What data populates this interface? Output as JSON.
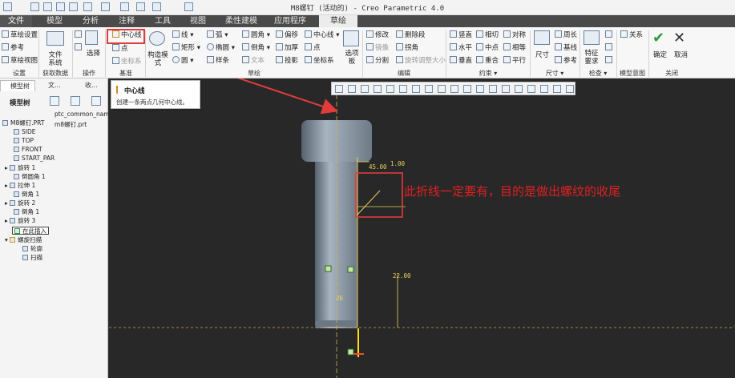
{
  "window": {
    "title": "M8螺钉 (活动的) - Creo Parametric 4.0"
  },
  "tabs": [
    {
      "label": "文件"
    },
    {
      "label": "模型"
    },
    {
      "label": "分析"
    },
    {
      "label": "注释"
    },
    {
      "label": "工具"
    },
    {
      "label": "视图"
    },
    {
      "label": "柔性建模"
    },
    {
      "label": "应用程序"
    },
    {
      "label": "草绘"
    }
  ],
  "ribbon": {
    "setup": {
      "sketch_setup": "草绘设置",
      "reference": "参考",
      "sketch_view": "草绘视图",
      "group": "设置"
    },
    "getdata": {
      "file_system": "文件系统",
      "group": "获取数据"
    },
    "operations": {
      "select": "选择",
      "group": "操作"
    },
    "datum": {
      "centerline": "中心线",
      "point": "点",
      "csys": "坐标系",
      "group": "基准"
    },
    "sketch": {
      "construction_mode": "构造模式",
      "line": "线",
      "rectangle": "矩形",
      "circle": "圆",
      "arc": "弧",
      "ellipse": "椭圆",
      "spline": "样条",
      "fillet": "圆角",
      "chamfer": "倒角",
      "text": "文本",
      "offset": "偏移",
      "thicken": "加厚",
      "project": "投影",
      "centerline": "中心线",
      "point": "点",
      "csys": "坐标系",
      "palette": "选项板",
      "group": "草绘"
    },
    "editing": {
      "modify": "修改",
      "mirror": "镜像",
      "divide": "分割",
      "delete_segment": "删除段",
      "corner": "拐角",
      "rotate_resize": "旋转调整大小",
      "group": "编辑"
    },
    "constrain": {
      "vertical": "竖直",
      "horizontal": "水平",
      "perpendicular": "垂直",
      "tangent": "相切",
      "midpoint": "中点",
      "coincident": "重合",
      "symmetric": "对称",
      "equal": "相等",
      "parallel": "平行",
      "group": "约束"
    },
    "dimension": {
      "dimension": "尺寸",
      "perimeter": "周长",
      "baseline": "基线",
      "reference": "参考",
      "group": "尺寸"
    },
    "inspect": {
      "feature_requirements": "特征要求",
      "relations": "关系",
      "group": "检查"
    },
    "model_intent": {
      "group": "模型意图"
    },
    "close": {
      "ok": "确定",
      "cancel": "取消",
      "group": "关闭"
    }
  },
  "tooltip": {
    "title": "中心线",
    "desc": "创建一条两点几何中心线。"
  },
  "panel": {
    "tabs": [
      {
        "label": "模型树"
      },
      {
        "label": "文..."
      },
      {
        "label": "收..."
      }
    ],
    "label": "模型树",
    "column_header": "ptc_common_name",
    "column_value": "m8螺钉.prt",
    "items": [
      {
        "label": "M8螺钉.PRT"
      },
      {
        "label": "SIDE"
      },
      {
        "label": "TOP"
      },
      {
        "label": "FRONT"
      },
      {
        "label": "START_PAR"
      },
      {
        "label": "旋转 1"
      },
      {
        "label": "倒圆角 1"
      },
      {
        "label": "拉伸 1"
      },
      {
        "label": "倒角 1"
      },
      {
        "label": "旋转 2"
      },
      {
        "label": "倒角 1"
      },
      {
        "label": "旋转 3"
      },
      {
        "label": "在此插入"
      },
      {
        "label": "螺旋扫描"
      },
      {
        "label": "轮廓"
      },
      {
        "label": "扫描"
      }
    ]
  },
  "canvas": {
    "callout": "此折线一定要有，目的是做出螺纹的收尾",
    "dims": {
      "d1": "45.00",
      "d2": "1.00",
      "d3": "22.00",
      "d4": "26"
    }
  },
  "colors": {
    "accent": "#e23b3b",
    "dimension": "#e6d25a",
    "background": "#282828"
  }
}
